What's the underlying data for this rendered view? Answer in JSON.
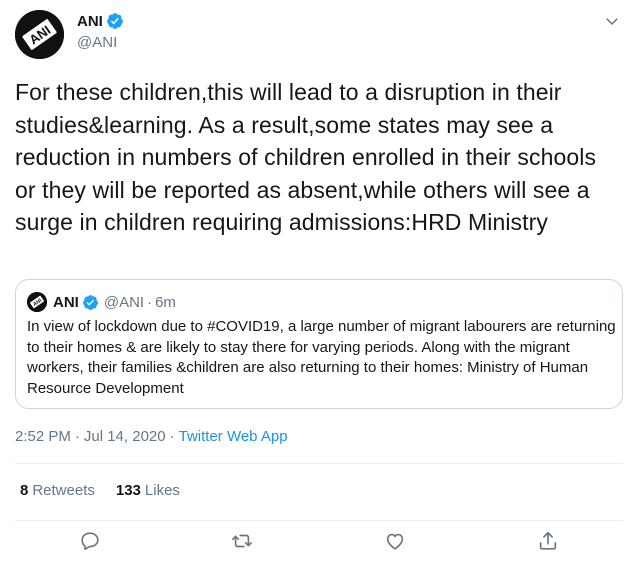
{
  "author": {
    "name": "ANI",
    "handle": "@ANI",
    "avatar_text": "ANI",
    "verified": true
  },
  "tweet": {
    "text": "For these children,this will lead to a disruption in their studies&learning. As a result,some states may see a reduction in numbers of children enrolled in their schools or they will be reported as absent,while others will see a surge in children requiring admissions:HRD Ministry"
  },
  "quoted_tweet": {
    "name": "ANI",
    "handle": "@ANI",
    "separator": "·",
    "time": "6m",
    "text": "In view of lockdown due to #COVID19, a large number of migrant labourers are returning to their homes & are likely to stay there for varying periods. Along with the migrant workers, their families &children are also returning to their homes: Ministry of Human Resource Development"
  },
  "meta": {
    "time": "2:52 PM",
    "separator1": "·",
    "date": "Jul 14, 2020",
    "separator2": "·",
    "source": "Twitter Web App"
  },
  "stats": {
    "retweets_count": "8",
    "retweets_label": "Retweets",
    "likes_count": "133",
    "likes_label": "Likes"
  },
  "colors": {
    "link": "#1b95e0",
    "verified": "#1da1f2",
    "secondary_text": "#657786",
    "border": "#e6ecf0"
  },
  "icons": [
    "chevron-down-icon",
    "verified-badge-icon",
    "reply-icon",
    "retweet-icon",
    "like-icon",
    "share-icon"
  ]
}
